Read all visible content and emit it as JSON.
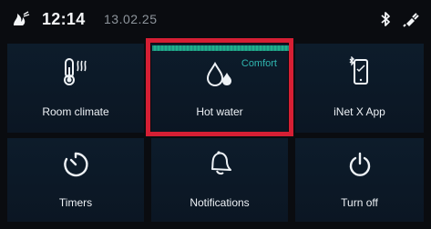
{
  "status": {
    "time": "12:14",
    "date": "13.02.25"
  },
  "tiles": [
    {
      "label": "Room climate",
      "icon": "thermometer-icon"
    },
    {
      "label": "Hot water",
      "icon": "water-drops-icon",
      "badge": "Comfort"
    },
    {
      "label": "iNet X App",
      "icon": "phone-app-icon"
    },
    {
      "label": "Timers",
      "icon": "timer-icon"
    },
    {
      "label": "Notifications",
      "icon": "bell-icon"
    },
    {
      "label": "Turn off",
      "icon": "power-icon"
    }
  ],
  "colors": {
    "highlight": "#d61f34",
    "accent": "#2fb6b0",
    "tile": "#0d1c2b"
  }
}
